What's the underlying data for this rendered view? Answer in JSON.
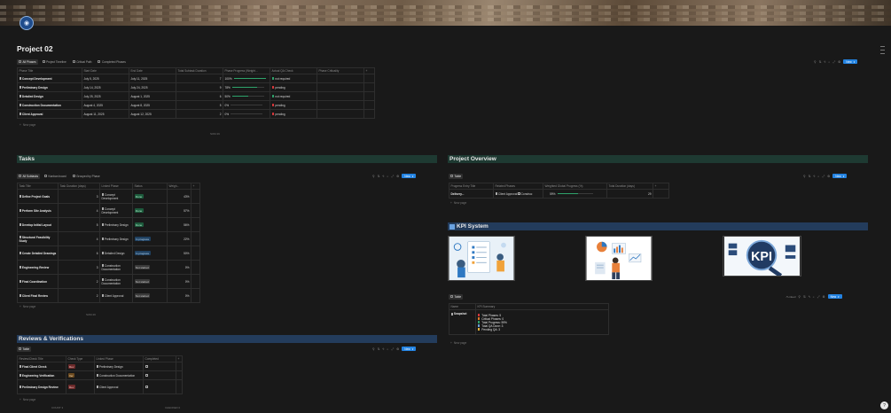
{
  "page": {
    "title": "Project 02",
    "icon": "globe-icon"
  },
  "phases": {
    "tabs": [
      {
        "label": "All Phases",
        "icon": "table-icon"
      },
      {
        "label": "Project Timeline",
        "icon": "timeline-icon"
      },
      {
        "label": "Critical Path",
        "icon": "list-icon"
      },
      {
        "label": "Completed Phases",
        "icon": "check-icon"
      }
    ],
    "new_label": "New",
    "columns": [
      "Phase Title",
      "Start Date",
      "End Date",
      "Total Subtask Duration",
      "Phase Progress (Weight...",
      "Actual QA Check",
      "Phase Criticality"
    ],
    "rows": [
      {
        "title": "Concept Development",
        "start": "July 5, 2025",
        "end": "July 11, 2025",
        "duration": "7",
        "progress": "100%",
        "progress_value": 1.0,
        "qa": "not required",
        "qa_color": "#2ea36b"
      },
      {
        "title": "Preliminary Design",
        "start": "July 14, 2025",
        "end": "July 24, 2025",
        "duration": "9",
        "progress": "78%",
        "progress_value": 0.78,
        "qa": "pending",
        "qa_color": "#d8383b"
      },
      {
        "title": "Detailed Design",
        "start": "July 25, 2025",
        "end": "August 1, 2025",
        "duration": "6",
        "progress": "50%",
        "progress_value": 0.5,
        "qa": "not required",
        "qa_color": "#2ea36b"
      },
      {
        "title": "Construction Documentation",
        "start": "August 4, 2025",
        "end": "August 8, 2025",
        "duration": "5",
        "progress": "0%",
        "progress_value": 0.0,
        "qa": "pending",
        "qa_color": "#d8383b"
      },
      {
        "title": "Client Approval",
        "start": "August 11, 2025",
        "end": "August 12, 2025",
        "duration": "2",
        "progress": "0%",
        "progress_value": 0.0,
        "qa": "pending",
        "qa_color": "#d8383b"
      }
    ],
    "new_page_label": "New page",
    "sum_label": "SUM 29"
  },
  "tasks": {
    "heading": "Tasks",
    "tabs": [
      {
        "label": "All Subtasks",
        "icon": "table-icon"
      },
      {
        "label": "Kanban board",
        "icon": "board-icon"
      },
      {
        "label": "Grouped by Phase",
        "icon": "list-icon"
      }
    ],
    "new_label": "New",
    "columns": [
      "Task Title",
      "Task Duration (days)",
      "Linked Phase",
      "Status",
      "Weigh..."
    ],
    "rows": [
      {
        "title": "Define Project Goals",
        "duration": "3",
        "phase": "Concept Development",
        "status": "Done",
        "status_kind": "done",
        "weight": "43%"
      },
      {
        "title": "Perform Site Analysis",
        "duration": "4",
        "phase": "Concept Development",
        "status": "Done",
        "status_kind": "done",
        "weight": "57%"
      },
      {
        "title": "Develop Initial Layout",
        "duration": "5",
        "phase": "Preliminary Design",
        "status": "Done",
        "status_kind": "done",
        "weight": "56%"
      },
      {
        "title": "Structural Feasibility Study",
        "duration": "4",
        "phase": "Preliminary Design",
        "status": "In progress",
        "status_kind": "prog",
        "weight": "22%"
      },
      {
        "title": "Create Detailed Drawings",
        "duration": "6",
        "phase": "Detailed Design",
        "status": "In progress",
        "status_kind": "prog",
        "weight": "50%"
      },
      {
        "title": "Engineering Review",
        "duration": "3",
        "phase": "Construction Documentation",
        "status": "Not started",
        "status_kind": "notst",
        "weight": "0%"
      },
      {
        "title": "Final Coordination",
        "duration": "2",
        "phase": "Construction Documentation",
        "status": "Not started",
        "status_kind": "notst",
        "weight": "0%"
      },
      {
        "title": "Client Final Review",
        "duration": "2",
        "phase": "Client Approval",
        "status": "Not started",
        "status_kind": "notst",
        "weight": "0%"
      }
    ],
    "new_page_label": "New page",
    "sum_label": "SUM 29"
  },
  "overview": {
    "heading": "Project Overview",
    "tab_label": "Table",
    "new_label": "New",
    "columns": [
      "Progress Entry Title",
      "Related Phases",
      "Weighted Global Progress (%)",
      "Total Duration (days)"
    ],
    "row": {
      "title": "Delivery...",
      "phases": [
        "Client Approval",
        "Construc"
      ],
      "progress": "59%",
      "progress_value": 0.59,
      "duration": "29"
    },
    "new_page_label": "New page"
  },
  "kpi": {
    "heading": "KPI System",
    "images": [
      "kpi-checklist-illustration",
      "kpi-analyst-illustration",
      "kpi-magnifier-illustration"
    ],
    "tab_label": "Table",
    "new_label": "New",
    "linked_label": "Linked",
    "columns": [
      "Name",
      "KPI Summary"
    ],
    "row_name": "Snapshot",
    "summary": [
      {
        "text": "Total Phases: 5",
        "color": "#d8383b"
      },
      {
        "text": "Critical Phases: 0",
        "color": "#e07b28"
      },
      {
        "text": "Total Progress: 59%",
        "color": "#2ea36b"
      },
      {
        "text": "Total QA Done: 3",
        "color": "#6aa2e0"
      },
      {
        "text": "Pending QA: 3",
        "color": "#e8b43a"
      }
    ],
    "new_page_label": "New page"
  },
  "reviews": {
    "heading": "Reviews & Verifications",
    "tab_label": "Table",
    "new_label": "New",
    "columns": [
      "Review/Check Title",
      "Check Type",
      "Linked Phase",
      "Completed"
    ],
    "rows": [
      {
        "title": "Final Client Check",
        "type": "Rev",
        "type_kind": "lowp",
        "phase": "Preliminary Design"
      },
      {
        "title": "Engineering Verification",
        "type": "Ver",
        "type_kind": "medp",
        "phase": "Construction Documentation"
      },
      {
        "title": "Preliminary Design Review",
        "type": "Rev",
        "type_kind": "lowp",
        "phase": "Client Approval"
      }
    ],
    "new_page_label": "New page",
    "count_label_1": "COUNT 3",
    "count_label_2": "CHECKED 0"
  }
}
